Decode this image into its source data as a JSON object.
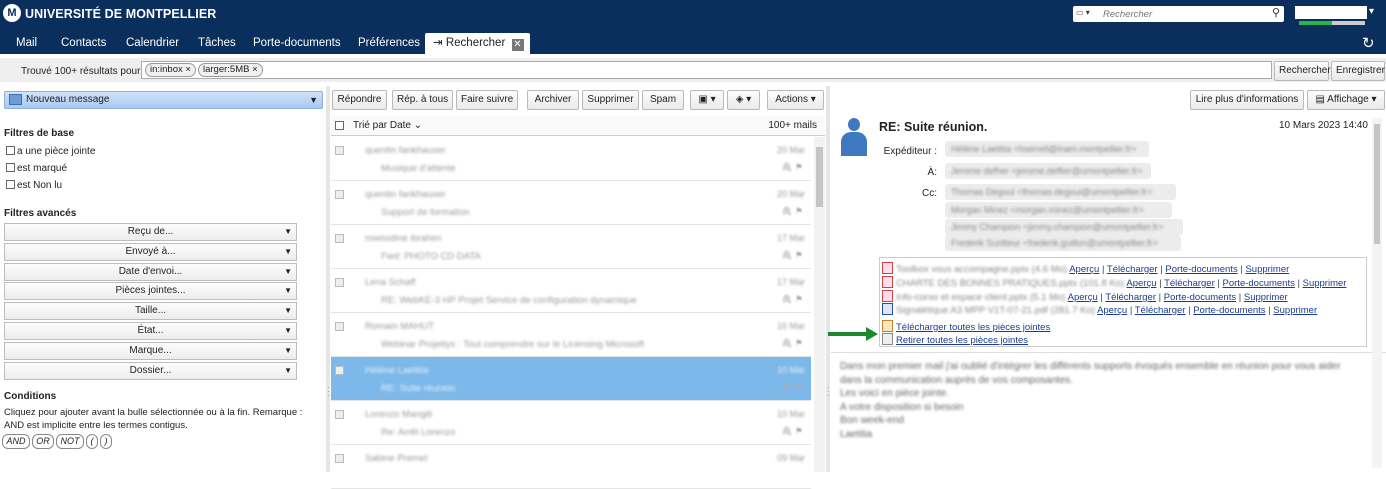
{
  "header": {
    "logo_mark": "M",
    "logo_text": "UNIVERSITÉ DE MONTPELLIER",
    "search_placeholder": "Rechercher",
    "search_icon": "magnifier-icon",
    "refresh_icon": "refresh-icon",
    "quota_fraction": 0.5
  },
  "tabs": [
    {
      "label": "Mail"
    },
    {
      "label": "Contacts"
    },
    {
      "label": "Calendrier"
    },
    {
      "label": "Tâches"
    },
    {
      "label": "Porte-documents"
    },
    {
      "label": "Préférences"
    },
    {
      "label": "Rechercher",
      "active": true
    }
  ],
  "query": {
    "result_label": "Trouvé 100+ résultats pour :",
    "tokens": [
      "in:inbox",
      "larger:5MB"
    ],
    "search_button": "Rechercher",
    "save_button": "Enregistrer"
  },
  "toolbar": {
    "new_message": "Nouveau message",
    "reply": "Répondre",
    "reply_all": "Rép. à tous",
    "forward": "Faire suivre",
    "archive": "Archiver",
    "delete": "Supprimer",
    "spam": "Spam",
    "actions": "Actions",
    "read_more": "Lire plus d'informations",
    "display": "Affichage"
  },
  "filters": {
    "basic_title": "Filtres de base",
    "basic": [
      "a une pièce jointe",
      "est marqué",
      "est Non lu"
    ],
    "advanced_title": "Filtres avancés",
    "advanced": [
      "Reçu de...",
      "Envoyé à...",
      "Date d'envoi...",
      "Pièces jointes...",
      "Taille...",
      "État...",
      "Marque...",
      "Dossier..."
    ],
    "conditions_title": "Conditions",
    "conditions_text": "Cliquez pour ajouter avant la bulle sélectionnée ou à la fin. Remarque : AND est implicite entre les termes contigus.",
    "operators": [
      "AND",
      "OR",
      "NOT",
      "(",
      ")"
    ]
  },
  "list": {
    "sort_label": "Trié par Date",
    "count_label": "100+ mails",
    "rows": [
      {
        "sender": "quentin fankhauser",
        "subject": "Musique d'attente",
        "date": "20 Mar"
      },
      {
        "sender": "quentin fankhauser",
        "subject": "Support de formation",
        "date": "20 Mar"
      },
      {
        "sender": "rowssdine ibrahim",
        "subject": "Fwd: PHOTO CD DATA",
        "date": "17 Mar"
      },
      {
        "sender": "Lena Schaff",
        "subject": "RE: WebKE-3 HP Projet Service de configuration dynamique",
        "date": "17 Mar"
      },
      {
        "sender": "Romain MAHUT",
        "subject": "Webinar Projetiys : Tout comprendre sur le Licensing Microsoft",
        "date": "16 Mar"
      },
      {
        "sender": "Hélène Laetitia",
        "subject": "RE: Suite réunion",
        "date": "10 Mar",
        "selected": true
      },
      {
        "sender": "Lorenzo Mangili",
        "subject": "Re: Arrêt Lorenzo",
        "date": "10 Mar"
      },
      {
        "sender": "Sabine Premel",
        "subject": "",
        "date": "09 Mar"
      }
    ]
  },
  "message": {
    "subject": "RE: Suite réunion.",
    "date": "10 Mars 2023 14:40",
    "from_label": "Expéditeur :",
    "to_label": "À:",
    "cc_label": "Cc:",
    "from": [
      "Hélène Laetitia <hserrell@lnam.montpellier.fr>"
    ],
    "to": [
      "Jerome defher <jerome.deffier@umontpellier.fr>"
    ],
    "cc": [
      "Thomas Degoul <thomas.degoul@umontpellier.fr>",
      "Morgan Minez <morgan.minez@umontpellier.fr>",
      "Jimmy Champion <jimmy.champion@umontpellier.fr>",
      "Frederik Suritteur <frederik.guillon@umontpellier.fr>"
    ],
    "attachments": [
      {
        "name": "Toolbox vous accompagne.pptx (4.6 Mo)",
        "links": [
          "Aperçu",
          "Télécharger",
          "Porte-documents",
          "Supprimer"
        ]
      },
      {
        "name": "CHARTE DES BONNES PRATIQUES.pptx (101.8 Ko)",
        "links": [
          "Aperçu",
          "Télécharger",
          "Porte-documents",
          "Supprimer"
        ]
      },
      {
        "name": "Info-corso et espace client.pptx (5.1 Mo)",
        "links": [
          "Aperçu",
          "Télécharger",
          "Porte-documents",
          "Supprimer"
        ]
      },
      {
        "name": "Signalétique A3 MPP V1T-07-21.pdf (281.7 Ko)",
        "links": [
          "Aperçu",
          "Télécharger",
          "Porte-documents",
          "Supprimer"
        ]
      }
    ],
    "download_all": "Télécharger toutes les pièces jointes",
    "remove_all": "Retirer toutes les pièces jointes",
    "body": [
      "Dans mon premier mail j'ai oublié d'intégrer les différents supports évoqués ensemble en réunion pour vous aider dans la communication auprès de vos composantes.",
      "Les voici en pièce jointe.",
      "A votre disposition si besoin",
      "Bon week-end",
      "Laetitia"
    ]
  }
}
